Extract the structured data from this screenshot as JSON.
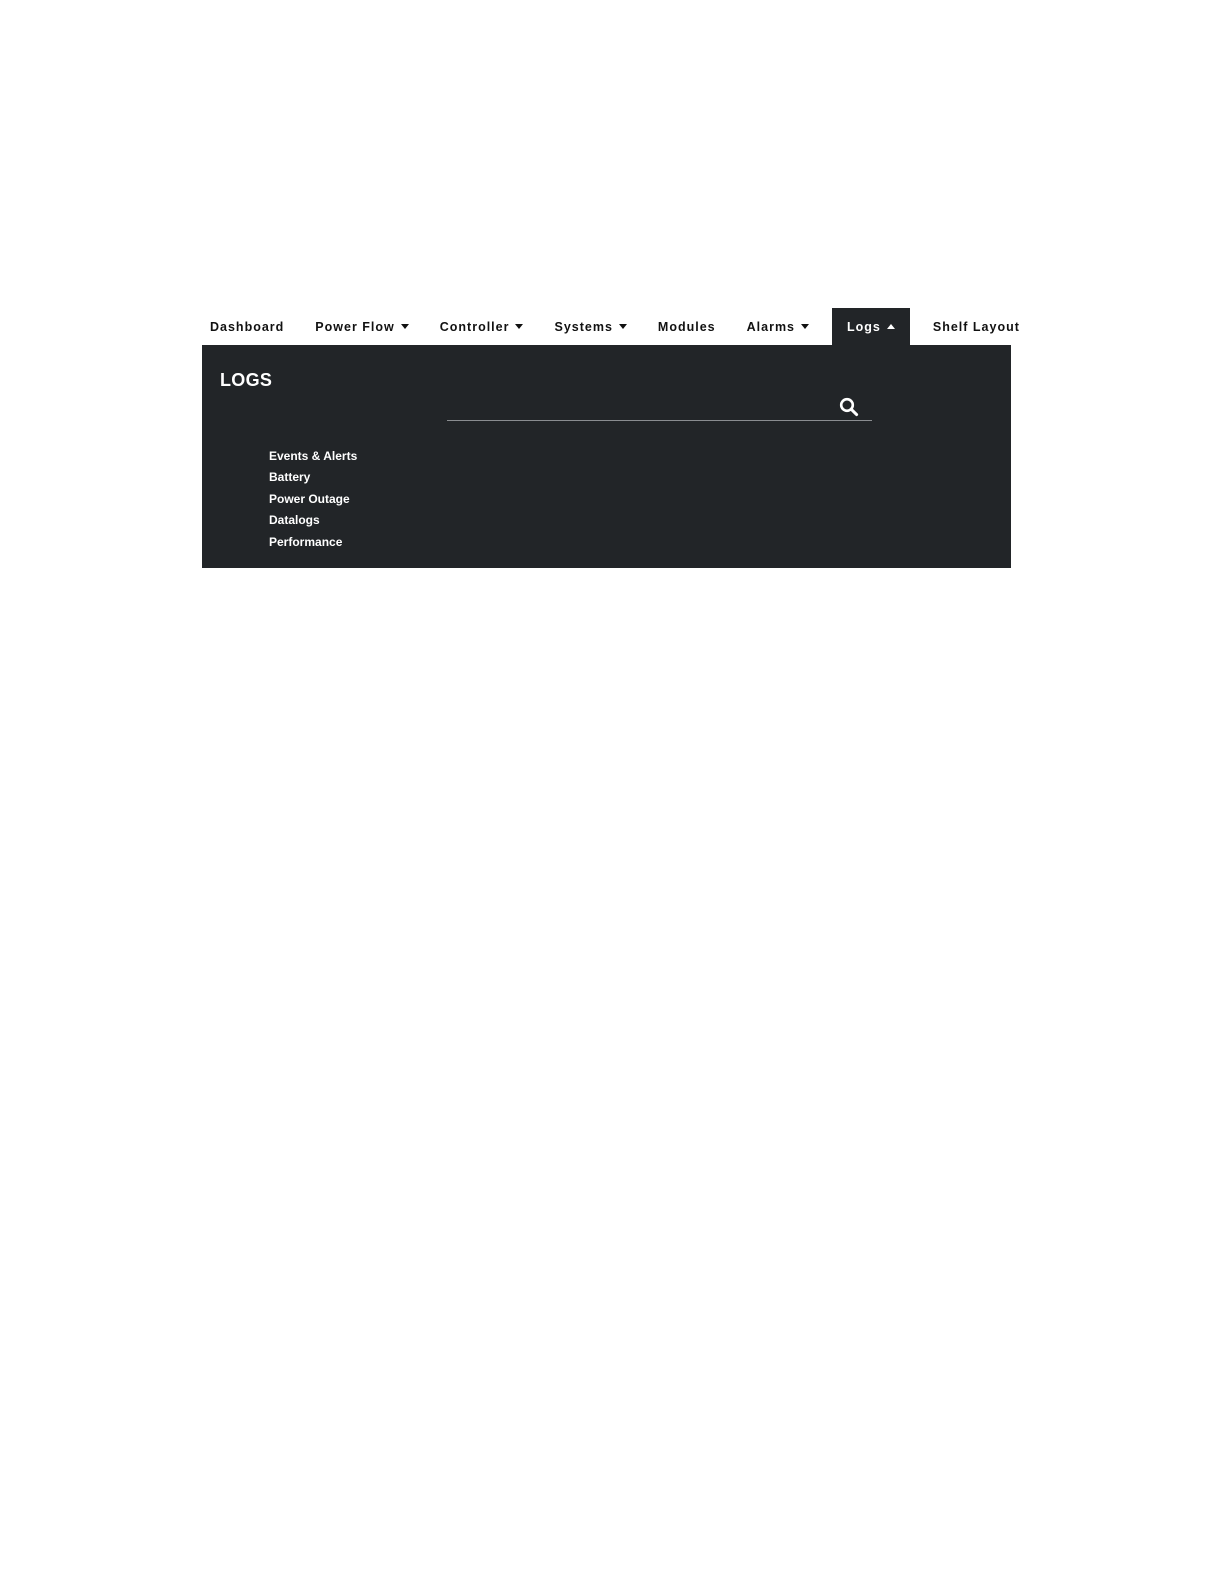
{
  "nav": {
    "items": [
      {
        "label": "Dashboard",
        "has_caret": false,
        "active": false
      },
      {
        "label": "Power Flow",
        "has_caret": true,
        "active": false
      },
      {
        "label": "Controller",
        "has_caret": true,
        "active": false
      },
      {
        "label": "Systems",
        "has_caret": true,
        "active": false
      },
      {
        "label": "Modules",
        "has_caret": false,
        "active": false
      },
      {
        "label": "Alarms",
        "has_caret": true,
        "active": false
      },
      {
        "label": "Logs",
        "has_caret": true,
        "active": true
      },
      {
        "label": "Shelf Layout",
        "has_caret": false,
        "active": false
      }
    ]
  },
  "panel": {
    "title": "LOGS",
    "search": {
      "value": "",
      "placeholder": "",
      "icon": "search-icon"
    },
    "menu": [
      "Events & Alerts",
      "Battery",
      "Power Outage",
      "Datalogs",
      "Performance"
    ]
  },
  "colors": {
    "panel_bg": "#222528",
    "nav_text": "#111111",
    "panel_text": "#ffffff",
    "search_underline": "#8a8d90"
  }
}
